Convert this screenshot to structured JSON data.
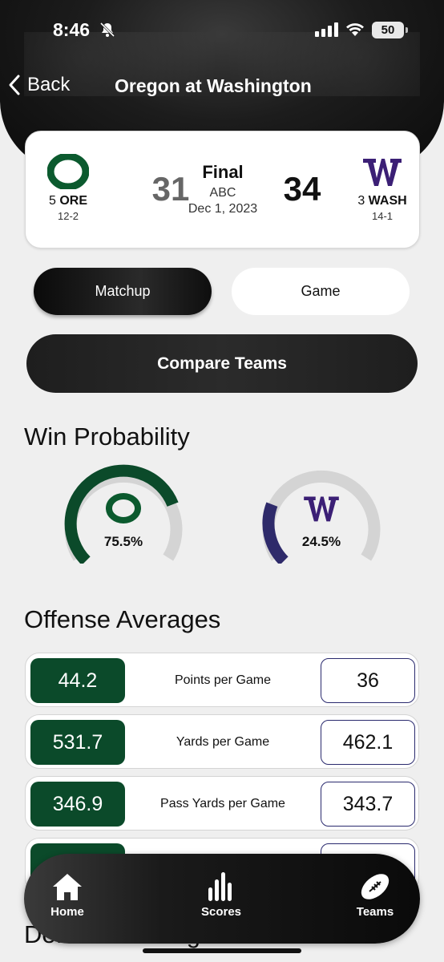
{
  "status_bar": {
    "time": "8:46",
    "battery": "50"
  },
  "nav": {
    "back_label": "Back",
    "title": "Oregon at Washington"
  },
  "game": {
    "away": {
      "rank": "5",
      "abbr": "ORE",
      "record": "12-2",
      "score": "31",
      "logo_letter": "O",
      "color": "#0b5a2e"
    },
    "home": {
      "rank": "3",
      "abbr": "WASH",
      "record": "14-1",
      "score": "34",
      "logo_letter": "W",
      "color": "#3b1f75"
    },
    "status": "Final",
    "network": "ABC",
    "date": "Dec 1, 2023"
  },
  "segments": {
    "matchup": "Matchup",
    "game": "Game",
    "active": "matchup"
  },
  "compare_label": "Compare Teams",
  "win_probability": {
    "title": "Win Probability",
    "away": {
      "pct": "75.5%",
      "value": 0.755,
      "color": "#0b4a2a"
    },
    "home": {
      "pct": "24.5%",
      "value": 0.245,
      "color": "#2e2a6a"
    }
  },
  "offense": {
    "title": "Offense Averages",
    "rows": [
      {
        "label": "Points per Game",
        "away": "44.2",
        "home": "36"
      },
      {
        "label": "Yards per Game",
        "away": "531.7",
        "home": "462.1"
      },
      {
        "label": "Pass Yards per Game",
        "away": "346.9",
        "home": "343.7"
      }
    ]
  },
  "defense_title": "Defense Averages",
  "tabs": {
    "home": "Home",
    "scores": "Scores",
    "teams": "Teams",
    "active": "teams"
  }
}
